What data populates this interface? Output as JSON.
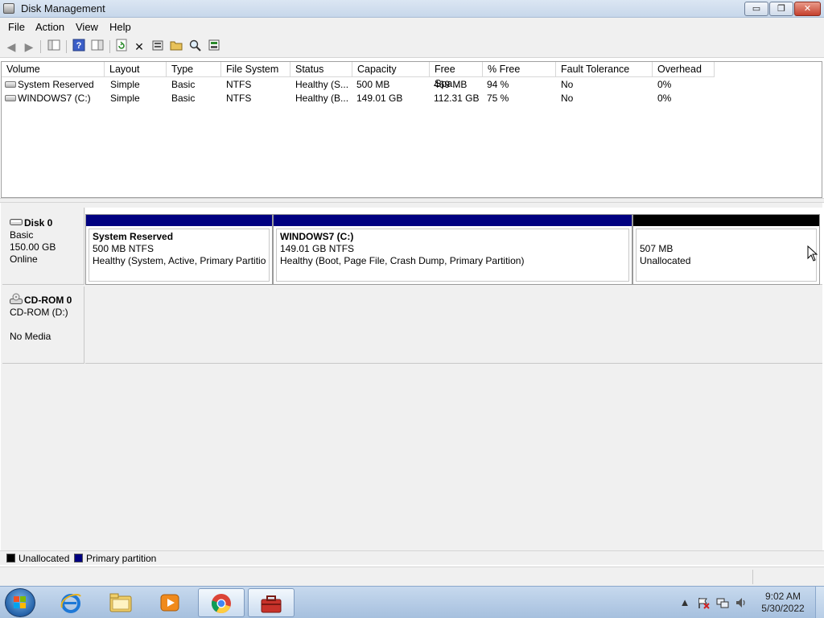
{
  "window": {
    "title": "Disk Management",
    "controls": {
      "minimize": "▭",
      "maximize": "❐",
      "close": "✕"
    }
  },
  "menu": [
    "File",
    "Action",
    "View",
    "Help"
  ],
  "toolbar": {
    "icons": [
      "back-arrow-icon",
      "forward-arrow-icon",
      "console-tree-icon",
      "help-icon",
      "properties-view-icon",
      "refresh-icon",
      "delete-icon",
      "properties-icon",
      "open-icon",
      "explore-icon",
      "rescan-disks-icon"
    ]
  },
  "volume_table": {
    "columns": [
      "Volume",
      "Layout",
      "Type",
      "File System",
      "Status",
      "Capacity",
      "Free Spa...",
      "% Free",
      "Fault Tolerance",
      "Overhead"
    ],
    "rows": [
      {
        "volume": "System Reserved",
        "layout": "Simple",
        "type": "Basic",
        "fs": "NTFS",
        "status": "Healthy (S...",
        "capacity": "500 MB",
        "free": "469 MB",
        "pct_free": "94 %",
        "fault": "No",
        "overhead": "0%"
      },
      {
        "volume": "WINDOWS7 (C:)",
        "layout": "Simple",
        "type": "Basic",
        "fs": "NTFS",
        "status": "Healthy (B...",
        "capacity": "149.01 GB",
        "free": "112.31 GB",
        "pct_free": "75 %",
        "fault": "No",
        "overhead": "0%"
      }
    ]
  },
  "disk0": {
    "name": "Disk 0",
    "type": "Basic",
    "size": "150.00 GB",
    "state": "Online",
    "partitions": [
      {
        "title": "System Reserved",
        "size": "500 MB NTFS",
        "status": "Healthy (System, Active, Primary Partition)",
        "kind": "primary"
      },
      {
        "title": "WINDOWS7  (C:)",
        "size": "149.01 GB NTFS",
        "status": "Healthy (Boot, Page File, Crash Dump, Primary Partition)",
        "kind": "primary"
      },
      {
        "title": "",
        "size": "507 MB",
        "status": "Unallocated",
        "kind": "unallocated"
      }
    ]
  },
  "cdrom0": {
    "name": "CD-ROM 0",
    "drive": "CD-ROM (D:)",
    "media": "No Media"
  },
  "legend": [
    {
      "label": "Unallocated",
      "color": "#000000"
    },
    {
      "label": "Primary partition",
      "color": "#000080"
    }
  ],
  "colors": {
    "primary_stripe": "#000080",
    "unallocated_stripe": "#000000"
  },
  "taskbar": {
    "pinned": [
      "start-button",
      "internet-explorer-icon",
      "windows-explorer-icon",
      "media-player-icon",
      "chrome-icon",
      "computer-management-icon"
    ],
    "clock_time": "9:02 AM",
    "clock_date": "5/30/2022"
  }
}
